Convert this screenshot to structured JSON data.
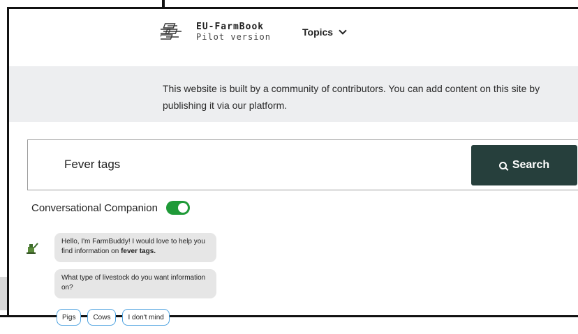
{
  "brand": {
    "name": "EU-FarmBook",
    "subtitle": "Pilot version"
  },
  "nav": {
    "topics_label": "Topics"
  },
  "banner": {
    "text": "This website is built by a community of contributors. You can add content on this site by publishing it via our platform."
  },
  "search": {
    "value": "Fever tags",
    "button_label": "Search"
  },
  "companion": {
    "label": "Conversational Companion",
    "enabled": true,
    "toggle_color": "#1f9a38"
  },
  "chat": {
    "msg1_prefix": "Hello, I'm FarmBuddy! I would love to help you find information on ",
    "msg1_bold": "fever tags.",
    "msg2": "What type of livestock do you want information on?",
    "options": [
      "Pigs",
      "Cows",
      "I don't mind"
    ]
  },
  "colors": {
    "search_button": "#263f3c",
    "banner_bg": "#edeef0",
    "chip_border": "#4fa3e0"
  }
}
